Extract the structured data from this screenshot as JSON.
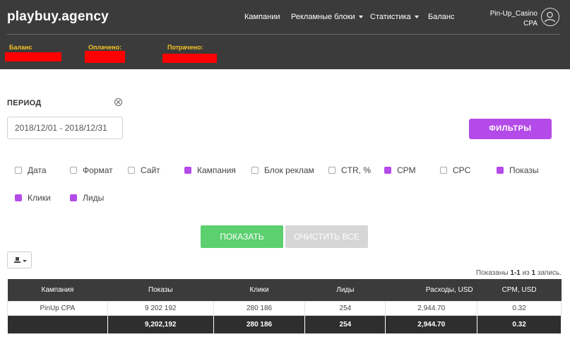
{
  "header": {
    "logo": "playbuy.agency",
    "nav": [
      {
        "label": "Кампании",
        "dropdown": false
      },
      {
        "label": "Рекламные блоки",
        "dropdown": true
      },
      {
        "label": "Статистика",
        "dropdown": true
      },
      {
        "label": "Баланс",
        "dropdown": false
      }
    ],
    "user_name": "Pin-Up_Casino",
    "user_role": "CPA",
    "stats": [
      {
        "label": "Баланс"
      },
      {
        "label": "Оплачено:"
      },
      {
        "label": "Потрачено:"
      }
    ]
  },
  "period": {
    "label": "ПЕРИОД",
    "value": "2018/12/01 - 2018/12/31"
  },
  "filters_button": "ФИЛЬТРЫ",
  "columns_options": [
    {
      "label": "Дата",
      "checked": false
    },
    {
      "label": "Формат",
      "checked": false
    },
    {
      "label": "Сайт",
      "checked": false
    },
    {
      "label": "Кампания",
      "checked": true
    },
    {
      "label": "Блок реклам",
      "checked": false
    },
    {
      "label": "CTR, %",
      "checked": false
    },
    {
      "label": "CPM",
      "checked": true
    },
    {
      "label": "CPC",
      "checked": false
    },
    {
      "label": "Показы",
      "checked": true
    },
    {
      "label": "Клики",
      "checked": true
    },
    {
      "label": "Лиды",
      "checked": true
    }
  ],
  "actions": {
    "show": "ПОКАЗАТЬ",
    "clear_all": "ОЧИСТИТЬ ВСЕ"
  },
  "pagination": {
    "prefix": "Показаны",
    "range": "1-1",
    "of": "из",
    "total": "1",
    "suffix": "запись."
  },
  "table": {
    "headers": [
      "Кампания",
      "Показы",
      "Клики",
      "Лиды",
      "Расходы, USD",
      "CPM, USD"
    ],
    "rows": [
      [
        "PinUp CPA",
        "9 202 192",
        "280 186",
        "254",
        "2,944.70",
        "0.32"
      ]
    ],
    "totals": [
      "",
      "9,202,192",
      "280 186",
      "254",
      "2,944.70",
      "0.32"
    ]
  },
  "colors": {
    "header_bg": "#3b3b3b",
    "accent": "#b44be8",
    "stat_label": "#f3c623",
    "show_button": "#5ccf6f",
    "clear_button": "#d6d6d6",
    "redaction": "#ff0000"
  }
}
